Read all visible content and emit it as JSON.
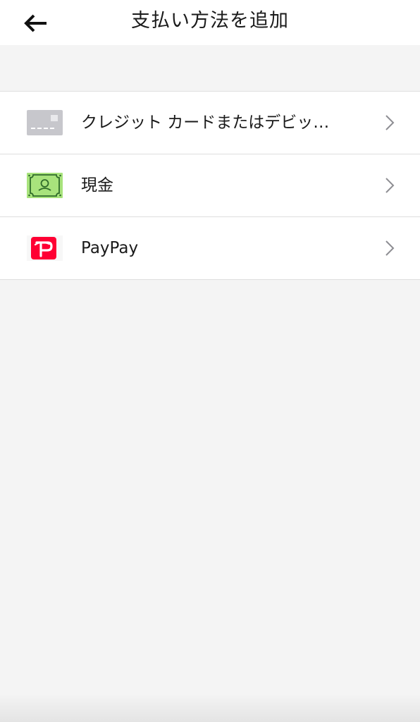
{
  "header": {
    "title": "支払い方法を追加",
    "back_icon": "arrow-left-icon"
  },
  "payment_methods": [
    {
      "label": "クレジット カードまたはデビッ…",
      "icon": "credit-card-icon",
      "icon_color": "#c7c7cc"
    },
    {
      "label": "現金",
      "icon": "cash-icon",
      "icon_color": "#a8e37c"
    },
    {
      "label": "PayPay",
      "icon": "paypay-icon",
      "icon_color": "#ff0033"
    }
  ],
  "colors": {
    "background": "#f4f4f4",
    "surface": "#ffffff",
    "divider": "#dedede",
    "chevron": "#8e8e93"
  }
}
